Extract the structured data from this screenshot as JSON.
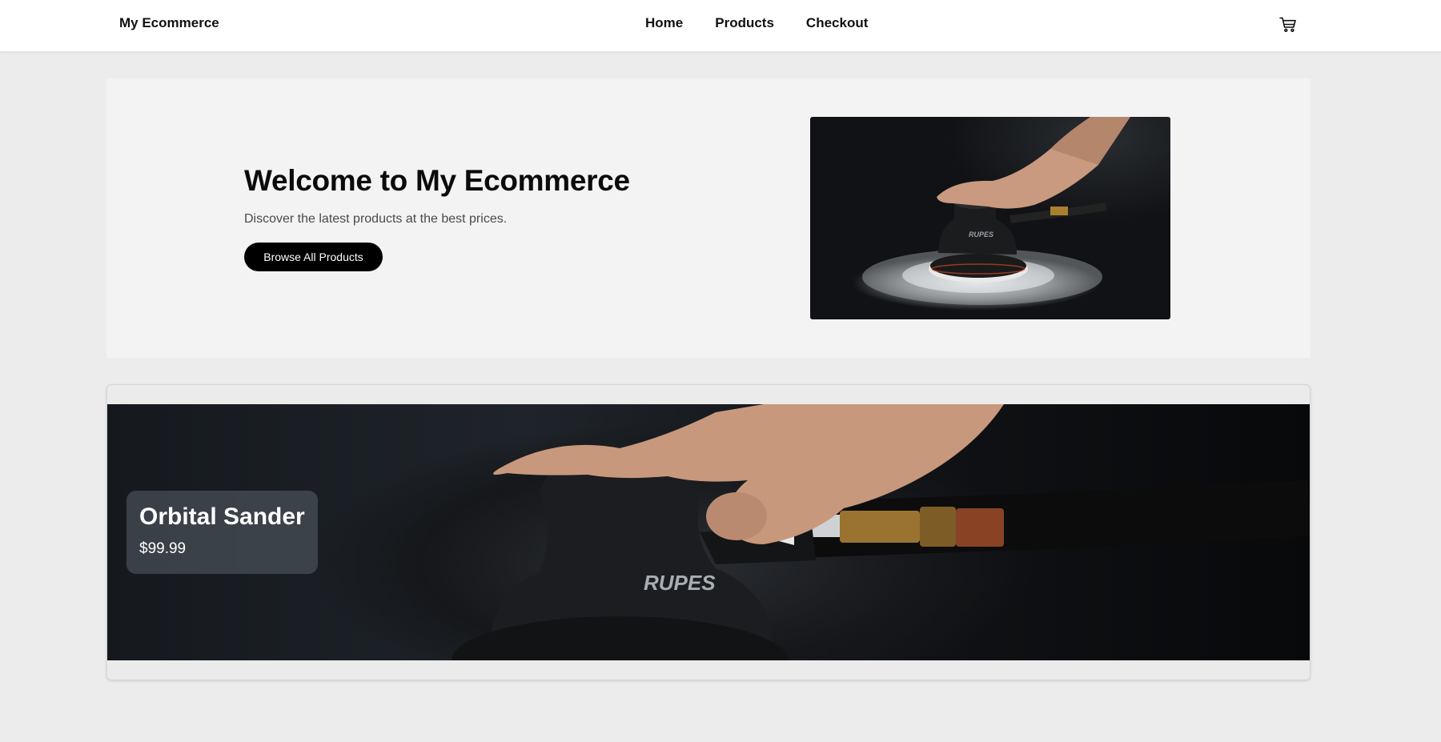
{
  "header": {
    "brand": "My Ecommerce",
    "nav": [
      "Home",
      "Products",
      "Checkout"
    ],
    "cart_icon": "shopping-cart-icon"
  },
  "hero": {
    "title": "Welcome to My Ecommerce",
    "subtitle": "Discover the latest products at the best prices.",
    "button_label": "Browse All Products",
    "image_logo_text": "RUPES"
  },
  "featured_product": {
    "name": "Orbital Sander",
    "price": "$99.99",
    "image_logo_text": "RUPES"
  },
  "colors": {
    "page_bg": "#ececec",
    "hero_bg": "#f3f3f3",
    "button_bg": "#000000",
    "text": "#111111"
  }
}
